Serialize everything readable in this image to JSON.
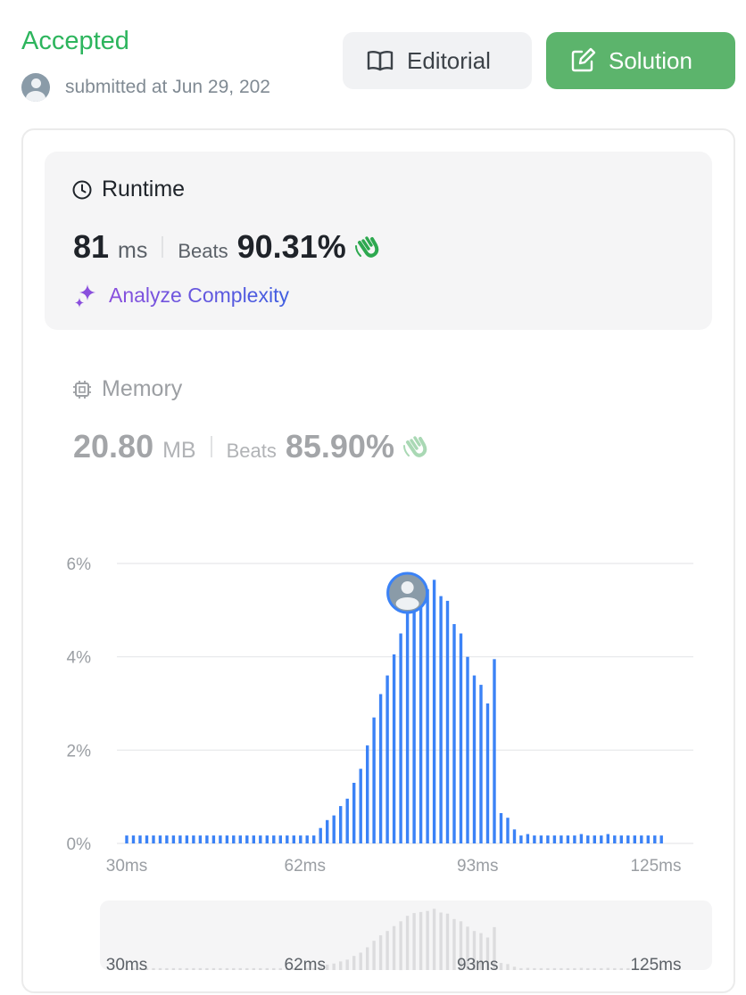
{
  "header": {
    "status": "Accepted",
    "submitted_text": "submitted at Jun 29, 202",
    "editorial_label": "Editorial",
    "solution_label": "Solution"
  },
  "runtime": {
    "title": "Runtime",
    "value": "81",
    "unit": "ms",
    "beats_label": "Beats",
    "beats_pct": "90.31%",
    "analyze_label": "Analyze Complexity"
  },
  "memory": {
    "title": "Memory",
    "value": "20.80",
    "unit": "MB",
    "beats_label": "Beats",
    "beats_pct": "85.90%"
  },
  "colors": {
    "accepted": "#2db55d",
    "bar": "#3b82f6",
    "solution_button": "#5cb46c"
  },
  "chart_data": {
    "type": "bar",
    "y_tick_labels": [
      "0%",
      "2%",
      "4%",
      "6%"
    ],
    "y_ticks": [
      0,
      2,
      4,
      6
    ],
    "ylim": [
      0,
      6
    ],
    "x_tick_labels": [
      "30ms",
      "62ms",
      "93ms",
      "125ms"
    ],
    "x_ticks": [
      30,
      62,
      93,
      125
    ],
    "xlim": [
      30,
      125
    ],
    "x": [
      30,
      31.2,
      32.4,
      33.6,
      34.8,
      36,
      37.2,
      38.4,
      39.6,
      40.8,
      42,
      43.2,
      44.4,
      45.6,
      46.8,
      48,
      49.2,
      50.4,
      51.6,
      52.8,
      54,
      55.2,
      56.4,
      57.6,
      58.8,
      60,
      61.2,
      62.4,
      63.6,
      64.8,
      66,
      67.2,
      68.4,
      69.6,
      70.8,
      72,
      73.2,
      74.4,
      75.6,
      76.8,
      78,
      79.2,
      80.4,
      81.6,
      82.8,
      84,
      85.2,
      86.4,
      87.6,
      88.8,
      90,
      91.2,
      92.4,
      93.6,
      94.8,
      96,
      97.2,
      98.4,
      99.6,
      100.8,
      102,
      103.2,
      104.4,
      105.6,
      106.8,
      108,
      109.2,
      110.4,
      111.6,
      112.8,
      114,
      115.2,
      116.4,
      117.6,
      118.8,
      120,
      121.2,
      122.4,
      123.6,
      124.8,
      126
    ],
    "values": [
      0.17,
      0.17,
      0.17,
      0.17,
      0.17,
      0.17,
      0.17,
      0.17,
      0.17,
      0.17,
      0.17,
      0.17,
      0.17,
      0.17,
      0.17,
      0.17,
      0.17,
      0.17,
      0.17,
      0.17,
      0.17,
      0.17,
      0.17,
      0.17,
      0.17,
      0.17,
      0.17,
      0.17,
      0.17,
      0.33,
      0.5,
      0.6,
      0.8,
      0.96,
      1.3,
      1.6,
      2.1,
      2.7,
      3.2,
      3.6,
      4.05,
      4.5,
      5.0,
      5.25,
      5.35,
      5.45,
      5.65,
      5.3,
      5.2,
      4.7,
      4.5,
      4.0,
      3.6,
      3.4,
      3.0,
      3.95,
      0.65,
      0.55,
      0.3,
      0.17,
      0.2,
      0.17,
      0.17,
      0.17,
      0.17,
      0.17,
      0.17,
      0.17,
      0.2,
      0.17,
      0.17,
      0.17,
      0.2,
      0.17,
      0.17,
      0.17,
      0.17,
      0.17,
      0.17,
      0.17,
      0.17
    ],
    "highlight_x": 81,
    "grid": true
  }
}
